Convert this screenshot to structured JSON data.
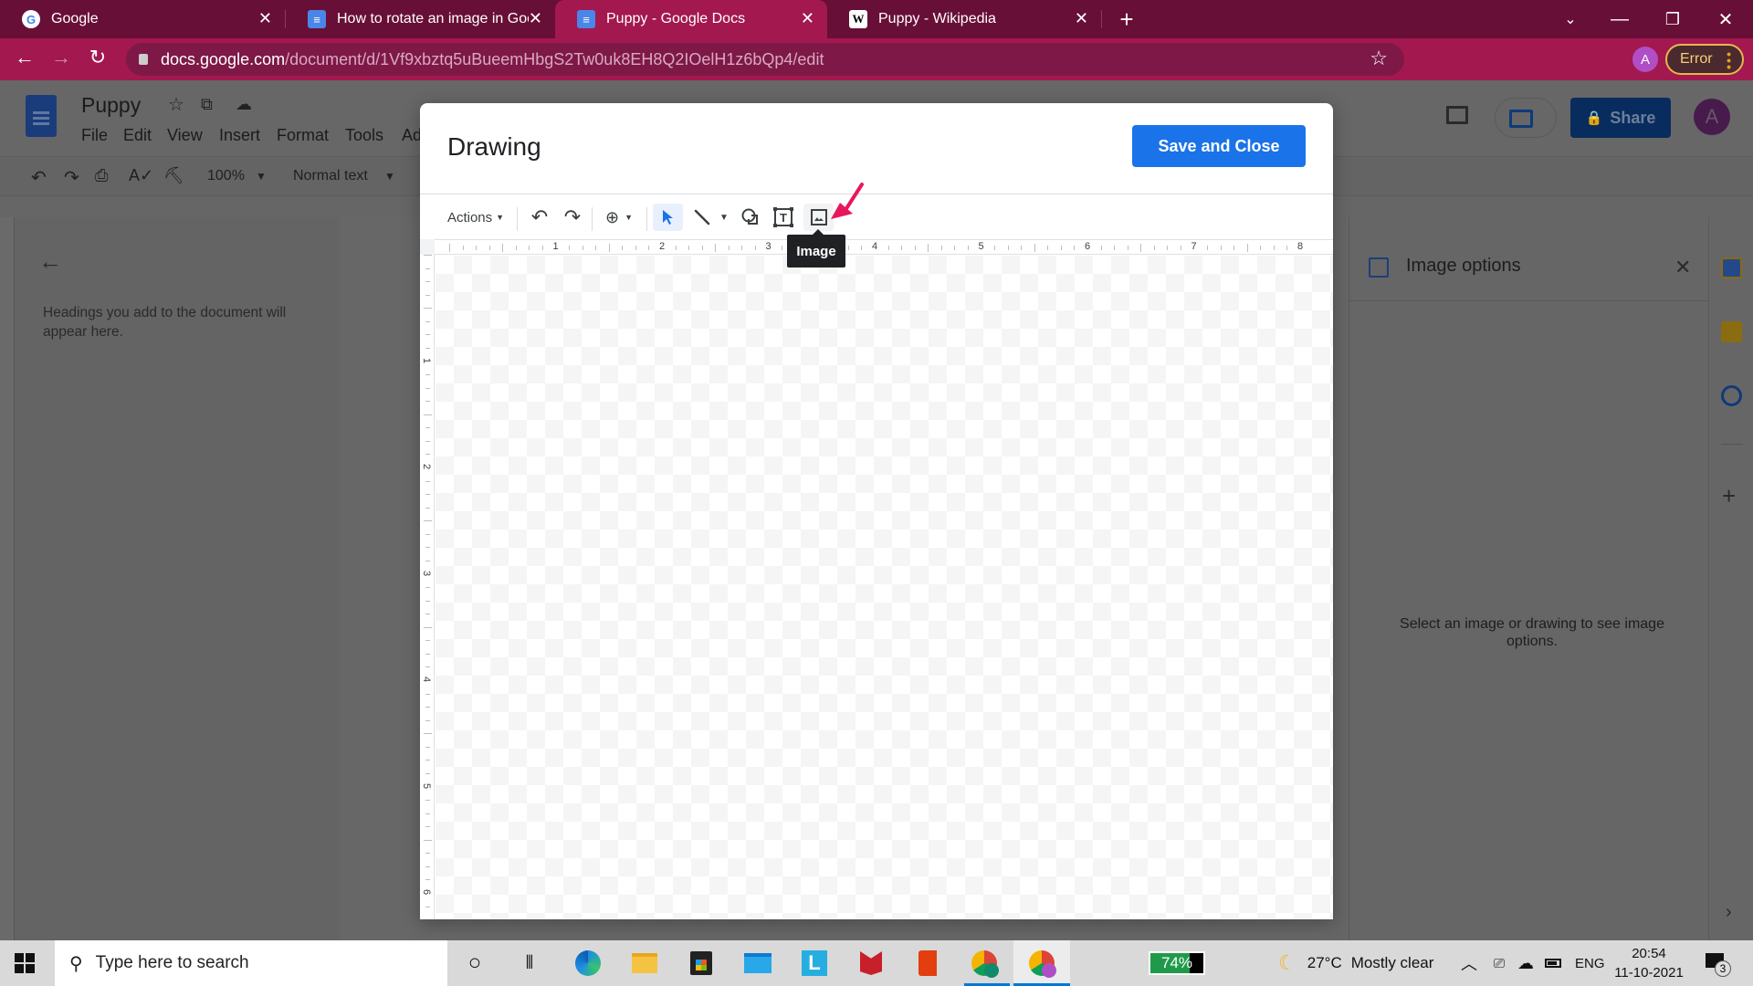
{
  "browser": {
    "tabs": [
      {
        "title": "Google",
        "favicon": "google-g-icon",
        "active": false
      },
      {
        "title": "How to rotate an image in Googl",
        "favicon": "google-docs-icon",
        "active": false
      },
      {
        "title": "Puppy - Google Docs",
        "favicon": "google-docs-icon",
        "active": true
      },
      {
        "title": "Puppy - Wikipedia",
        "favicon": "wikipedia-w-icon",
        "active": false
      }
    ],
    "new_tab_label": "+",
    "url_host": "docs.google.com",
    "url_path": "/document/d/1Vf9xbztq5uBueemHbgS2Tw0uk8EH8Q2IOelH1z6bQp4/edit",
    "profile_initial": "A",
    "error_label": "Error",
    "colors": {
      "frame": "#680f37",
      "toolbar": "#a3184f",
      "omnibox": "#7e1847"
    }
  },
  "docs": {
    "title": "Puppy",
    "menu": [
      "File",
      "Edit",
      "View",
      "Insert",
      "Format",
      "Tools",
      "Ad"
    ],
    "toolbar": {
      "zoom": "100%",
      "style": "Normal text"
    },
    "outline_text": "Headings you add to the document will appear here.",
    "share_label": "Share",
    "account_initial": "A",
    "side_panel": {
      "title": "Image options",
      "message": "Select an image or drawing to see image options."
    }
  },
  "drawing_dialog": {
    "title": "Drawing",
    "save_close_label": "Save and Close",
    "toolbar": {
      "actions_label": "Actions",
      "tools": [
        "undo",
        "redo",
        "zoom",
        "select",
        "line",
        "shape",
        "text-box",
        "image"
      ],
      "selected_tool": "select",
      "hovered_tool": "image"
    },
    "tooltip": "Image",
    "ruler_h": [
      "1",
      "2",
      "3",
      "4",
      "5",
      "6",
      "7",
      "8"
    ],
    "ruler_v": [
      "1",
      "2",
      "3",
      "4",
      "5",
      "6"
    ],
    "accent_color": "#1a73e8",
    "annotation_arrow_color": "#e8175d"
  },
  "taskbar": {
    "search_placeholder": "Type here to search",
    "battery_percent": "74%",
    "weather": {
      "temp": "27°C",
      "condition": "Mostly clear"
    },
    "language": "ENG",
    "time": "20:54",
    "date": "11-10-2021",
    "notification_count": "3"
  }
}
